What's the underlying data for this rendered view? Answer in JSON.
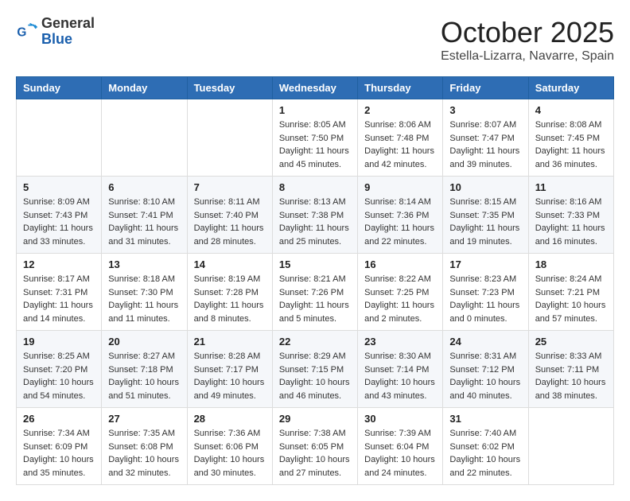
{
  "header": {
    "logo": {
      "general": "General",
      "blue": "Blue"
    },
    "title": "October 2025",
    "location": "Estella-Lizarra, Navarre, Spain"
  },
  "weekdays": [
    "Sunday",
    "Monday",
    "Tuesday",
    "Wednesday",
    "Thursday",
    "Friday",
    "Saturday"
  ],
  "weeks": [
    [
      {
        "day": "",
        "sunrise": "",
        "sunset": "",
        "daylight": ""
      },
      {
        "day": "",
        "sunrise": "",
        "sunset": "",
        "daylight": ""
      },
      {
        "day": "",
        "sunrise": "",
        "sunset": "",
        "daylight": ""
      },
      {
        "day": "1",
        "sunrise": "Sunrise: 8:05 AM",
        "sunset": "Sunset: 7:50 PM",
        "daylight": "Daylight: 11 hours and 45 minutes."
      },
      {
        "day": "2",
        "sunrise": "Sunrise: 8:06 AM",
        "sunset": "Sunset: 7:48 PM",
        "daylight": "Daylight: 11 hours and 42 minutes."
      },
      {
        "day": "3",
        "sunrise": "Sunrise: 8:07 AM",
        "sunset": "Sunset: 7:47 PM",
        "daylight": "Daylight: 11 hours and 39 minutes."
      },
      {
        "day": "4",
        "sunrise": "Sunrise: 8:08 AM",
        "sunset": "Sunset: 7:45 PM",
        "daylight": "Daylight: 11 hours and 36 minutes."
      }
    ],
    [
      {
        "day": "5",
        "sunrise": "Sunrise: 8:09 AM",
        "sunset": "Sunset: 7:43 PM",
        "daylight": "Daylight: 11 hours and 33 minutes."
      },
      {
        "day": "6",
        "sunrise": "Sunrise: 8:10 AM",
        "sunset": "Sunset: 7:41 PM",
        "daylight": "Daylight: 11 hours and 31 minutes."
      },
      {
        "day": "7",
        "sunrise": "Sunrise: 8:11 AM",
        "sunset": "Sunset: 7:40 PM",
        "daylight": "Daylight: 11 hours and 28 minutes."
      },
      {
        "day": "8",
        "sunrise": "Sunrise: 8:13 AM",
        "sunset": "Sunset: 7:38 PM",
        "daylight": "Daylight: 11 hours and 25 minutes."
      },
      {
        "day": "9",
        "sunrise": "Sunrise: 8:14 AM",
        "sunset": "Sunset: 7:36 PM",
        "daylight": "Daylight: 11 hours and 22 minutes."
      },
      {
        "day": "10",
        "sunrise": "Sunrise: 8:15 AM",
        "sunset": "Sunset: 7:35 PM",
        "daylight": "Daylight: 11 hours and 19 minutes."
      },
      {
        "day": "11",
        "sunrise": "Sunrise: 8:16 AM",
        "sunset": "Sunset: 7:33 PM",
        "daylight": "Daylight: 11 hours and 16 minutes."
      }
    ],
    [
      {
        "day": "12",
        "sunrise": "Sunrise: 8:17 AM",
        "sunset": "Sunset: 7:31 PM",
        "daylight": "Daylight: 11 hours and 14 minutes."
      },
      {
        "day": "13",
        "sunrise": "Sunrise: 8:18 AM",
        "sunset": "Sunset: 7:30 PM",
        "daylight": "Daylight: 11 hours and 11 minutes."
      },
      {
        "day": "14",
        "sunrise": "Sunrise: 8:19 AM",
        "sunset": "Sunset: 7:28 PM",
        "daylight": "Daylight: 11 hours and 8 minutes."
      },
      {
        "day": "15",
        "sunrise": "Sunrise: 8:21 AM",
        "sunset": "Sunset: 7:26 PM",
        "daylight": "Daylight: 11 hours and 5 minutes."
      },
      {
        "day": "16",
        "sunrise": "Sunrise: 8:22 AM",
        "sunset": "Sunset: 7:25 PM",
        "daylight": "Daylight: 11 hours and 2 minutes."
      },
      {
        "day": "17",
        "sunrise": "Sunrise: 8:23 AM",
        "sunset": "Sunset: 7:23 PM",
        "daylight": "Daylight: 11 hours and 0 minutes."
      },
      {
        "day": "18",
        "sunrise": "Sunrise: 8:24 AM",
        "sunset": "Sunset: 7:21 PM",
        "daylight": "Daylight: 10 hours and 57 minutes."
      }
    ],
    [
      {
        "day": "19",
        "sunrise": "Sunrise: 8:25 AM",
        "sunset": "Sunset: 7:20 PM",
        "daylight": "Daylight: 10 hours and 54 minutes."
      },
      {
        "day": "20",
        "sunrise": "Sunrise: 8:27 AM",
        "sunset": "Sunset: 7:18 PM",
        "daylight": "Daylight: 10 hours and 51 minutes."
      },
      {
        "day": "21",
        "sunrise": "Sunrise: 8:28 AM",
        "sunset": "Sunset: 7:17 PM",
        "daylight": "Daylight: 10 hours and 49 minutes."
      },
      {
        "day": "22",
        "sunrise": "Sunrise: 8:29 AM",
        "sunset": "Sunset: 7:15 PM",
        "daylight": "Daylight: 10 hours and 46 minutes."
      },
      {
        "day": "23",
        "sunrise": "Sunrise: 8:30 AM",
        "sunset": "Sunset: 7:14 PM",
        "daylight": "Daylight: 10 hours and 43 minutes."
      },
      {
        "day": "24",
        "sunrise": "Sunrise: 8:31 AM",
        "sunset": "Sunset: 7:12 PM",
        "daylight": "Daylight: 10 hours and 40 minutes."
      },
      {
        "day": "25",
        "sunrise": "Sunrise: 8:33 AM",
        "sunset": "Sunset: 7:11 PM",
        "daylight": "Daylight: 10 hours and 38 minutes."
      }
    ],
    [
      {
        "day": "26",
        "sunrise": "Sunrise: 7:34 AM",
        "sunset": "Sunset: 6:09 PM",
        "daylight": "Daylight: 10 hours and 35 minutes."
      },
      {
        "day": "27",
        "sunrise": "Sunrise: 7:35 AM",
        "sunset": "Sunset: 6:08 PM",
        "daylight": "Daylight: 10 hours and 32 minutes."
      },
      {
        "day": "28",
        "sunrise": "Sunrise: 7:36 AM",
        "sunset": "Sunset: 6:06 PM",
        "daylight": "Daylight: 10 hours and 30 minutes."
      },
      {
        "day": "29",
        "sunrise": "Sunrise: 7:38 AM",
        "sunset": "Sunset: 6:05 PM",
        "daylight": "Daylight: 10 hours and 27 minutes."
      },
      {
        "day": "30",
        "sunrise": "Sunrise: 7:39 AM",
        "sunset": "Sunset: 6:04 PM",
        "daylight": "Daylight: 10 hours and 24 minutes."
      },
      {
        "day": "31",
        "sunrise": "Sunrise: 7:40 AM",
        "sunset": "Sunset: 6:02 PM",
        "daylight": "Daylight: 10 hours and 22 minutes."
      },
      {
        "day": "",
        "sunrise": "",
        "sunset": "",
        "daylight": ""
      }
    ]
  ]
}
